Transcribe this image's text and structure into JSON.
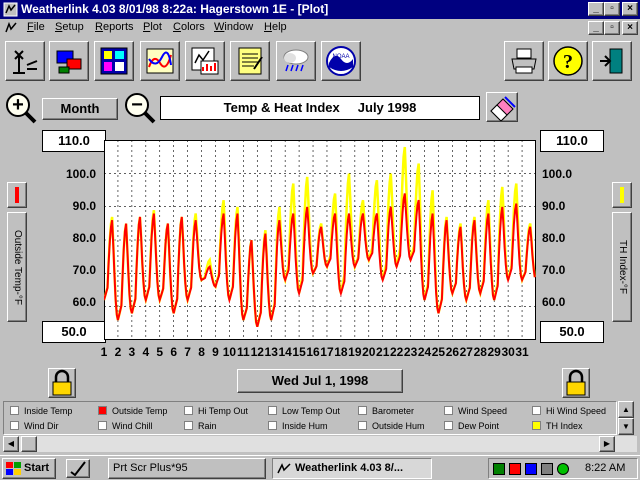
{
  "window": {
    "title": "Weatherlink 4.03   8/01/98   8:22a: Hagerstown 1E - [Plot]"
  },
  "menu": [
    {
      "key": "F",
      "rest": "ile"
    },
    {
      "key": "S",
      "rest": "etup"
    },
    {
      "key": "R",
      "rest": "eports"
    },
    {
      "key": "P",
      "rest": "lot"
    },
    {
      "key": "C",
      "rest": "olors"
    },
    {
      "key": "W",
      "rest": "indow"
    },
    {
      "key": "H",
      "rest": "elp"
    }
  ],
  "toolbar": {
    "icons": [
      "antenna-icon",
      "station-icon",
      "summary-icon",
      "chart-icon",
      "graph-report-icon",
      "notepad-icon",
      "weather-cloud-icon",
      "noaa-icon",
      "printer-icon",
      "help-icon",
      "exit-door-icon"
    ]
  },
  "controls": {
    "zoom_in": "+",
    "zoom_out": "−",
    "period_label": "Month",
    "plot_title": "Temp & Heat Index     July 1998"
  },
  "axis": {
    "left_top": "110.0",
    "left_bottom": "50.0",
    "right_top": "110.0",
    "right_bottom": "50.0",
    "left_ticks": [
      "100.0",
      "90.0",
      "80.0",
      "70.0",
      "60.0"
    ],
    "right_ticks": [
      "100.0",
      "90.0",
      "80.0",
      "70.0",
      "60.0"
    ],
    "left_label": "Outside Temp-°F",
    "right_label": "TH Index-°F"
  },
  "date_display": "Wed Jul 1, 1998",
  "legend": [
    {
      "label": "Inside Temp",
      "checked": false,
      "color": "#ffffff"
    },
    {
      "label": "Outside Temp",
      "checked": true,
      "color": "#ff0000"
    },
    {
      "label": "Hi Temp Out",
      "checked": false,
      "color": "#ffffff"
    },
    {
      "label": "Low Temp Out",
      "checked": false,
      "color": "#ffffff"
    },
    {
      "label": "Barometer",
      "checked": false,
      "color": "#ffffff"
    },
    {
      "label": "Wind Speed",
      "checked": false,
      "color": "#ffffff"
    },
    {
      "label": "Hi Wind Speed",
      "checked": false,
      "color": "#ffffff"
    },
    {
      "label": "Wind Dir",
      "checked": false,
      "color": "#ffffff"
    },
    {
      "label": "Wind Chill",
      "checked": false,
      "color": "#ffffff"
    },
    {
      "label": "Rain",
      "checked": false,
      "color": "#ffffff"
    },
    {
      "label": "Inside Hum",
      "checked": false,
      "color": "#ffffff"
    },
    {
      "label": "Outside Hum",
      "checked": false,
      "color": "#ffffff"
    },
    {
      "label": "Dew Point",
      "checked": false,
      "color": "#ffffff"
    },
    {
      "label": "TH Index",
      "checked": true,
      "color": "#ffff00"
    }
  ],
  "taskbar": {
    "start": "Start",
    "tasks": [
      "Prt Scr Plus*95",
      "Weatherlink 4.03    8/..."
    ],
    "clock": "8:22 AM"
  },
  "chart_data": {
    "type": "line",
    "xlim": [
      1,
      32
    ],
    "ylim": [
      50,
      110
    ],
    "x_ticks": [
      "1",
      "2",
      "3",
      "4",
      "5",
      "6",
      "7",
      "8",
      "9",
      "10",
      "11",
      "12",
      "13",
      "14",
      "15",
      "16",
      "17",
      "18",
      "19",
      "20",
      "21",
      "22",
      "23",
      "24",
      "25",
      "26",
      "27",
      "28",
      "29",
      "30",
      "31"
    ],
    "y_ticks": [
      50,
      60,
      70,
      80,
      90,
      100,
      110
    ],
    "grid": true,
    "colors": {
      "outside_temp": "#ff0000",
      "th_index": "#ffff00"
    },
    "days": [
      1,
      2,
      3,
      4,
      5,
      6,
      7,
      8,
      9,
      10,
      11,
      12,
      13,
      14,
      15,
      16,
      17,
      18,
      19,
      20,
      21,
      22,
      23,
      24,
      25,
      26,
      27,
      28,
      29,
      30,
      31
    ],
    "series": [
      {
        "name": "TH Index",
        "color": "#ffff00",
        "day_low": [
          62,
          56,
          58,
          62,
          62,
          58,
          62,
          68,
          66,
          62,
          56,
          54,
          56,
          68,
          64,
          70,
          72,
          64,
          72,
          74,
          68,
          72,
          74,
          62,
          58,
          64,
          62,
          64,
          62,
          68,
          68
        ],
        "day_high": [
          87,
          85,
          87,
          89,
          85,
          87,
          88,
          74,
          92,
          90,
          80,
          83,
          90,
          97,
          99,
          85,
          94,
          100,
          92,
          98,
          100,
          108,
          103,
          95,
          87,
          85,
          87,
          92,
          96,
          97,
          85
        ]
      },
      {
        "name": "Outside Temp",
        "color": "#ff0000",
        "day_low": [
          62,
          56,
          58,
          62,
          62,
          58,
          62,
          68,
          66,
          62,
          56,
          54,
          56,
          68,
          64,
          70,
          72,
          64,
          72,
          74,
          68,
          72,
          74,
          62,
          58,
          64,
          62,
          64,
          62,
          68,
          68
        ],
        "day_high": [
          86,
          85,
          87,
          88,
          85,
          87,
          86,
          72,
          88,
          88,
          80,
          82,
          86,
          88,
          90,
          84,
          88,
          88,
          88,
          88,
          90,
          94,
          92,
          88,
          86,
          84,
          86,
          88,
          90,
          91,
          84
        ]
      }
    ]
  }
}
